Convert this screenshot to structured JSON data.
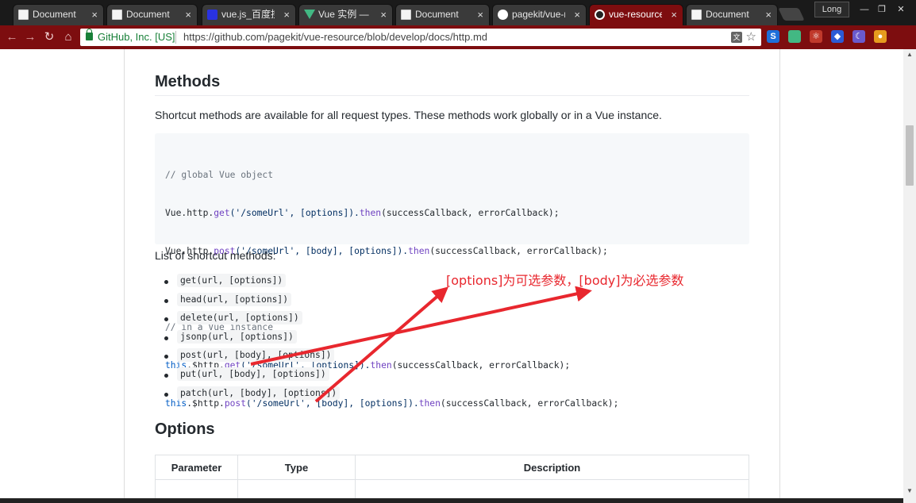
{
  "browser": {
    "tabs": [
      {
        "title": "Document",
        "favicon": "document-icon",
        "active": false
      },
      {
        "title": "Document",
        "favicon": "document-icon",
        "active": false
      },
      {
        "title": "vue.js_百度搜索",
        "favicon": "baidu-icon",
        "active": false
      },
      {
        "title": "Vue 实例 — Vue",
        "favicon": "vue-icon",
        "active": false
      },
      {
        "title": "Document",
        "favicon": "document-icon",
        "active": false
      },
      {
        "title": "pagekit/vue-re",
        "favicon": "github-icon",
        "active": false
      },
      {
        "title": "vue-resource/",
        "favicon": "github-icon",
        "active": true
      },
      {
        "title": "Document",
        "favicon": "document-icon",
        "active": false
      }
    ],
    "tab_close_glyph": "×",
    "profile_name": "Long",
    "window_controls": {
      "minimize": "—",
      "restore": "❐",
      "close": "✕"
    },
    "nav": {
      "back": "←",
      "forward": "→",
      "reload": "↻",
      "home": "⌂"
    },
    "address_bar": {
      "secure_label": "GitHub, Inc. [US]",
      "url": "https://github.com/pagekit/vue-resource/blob/develop/docs/http.md"
    },
    "extensions": [
      {
        "name": "s-extension-icon",
        "glyph": "S",
        "color": "#1e6fd9"
      },
      {
        "name": "vue-devtools-icon",
        "glyph": "",
        "color": "#42b883"
      },
      {
        "name": "react-devtools-icon",
        "glyph": "⚛",
        "color": "#c0392b"
      },
      {
        "name": "blue-extension-icon",
        "glyph": "◆",
        "color": "#2c5bd6"
      },
      {
        "name": "moon-extension-icon",
        "glyph": "☾",
        "color": "#6a5acd"
      },
      {
        "name": "cookie-extension-icon",
        "glyph": "●",
        "color": "#e69b1e"
      }
    ],
    "accent_color": "#7d0d0f"
  },
  "page": {
    "methods_heading": "Methods",
    "methods_intro": "Shortcut methods are available for all request types. These methods work globally or in a Vue instance.",
    "code": {
      "comment_global": "// global Vue object",
      "line_get_prefix": "Vue.http.",
      "line_get_fn": "get",
      "line_get_rest": "('/someUrl', [options]).",
      "line_then": "then",
      "line_get_tail": "(successCallback, errorCallback);",
      "line_post_prefix": "Vue.http.",
      "line_post_fn": "post",
      "line_post_rest": "('/someUrl', [body], [options]).",
      "line_post_tail": "(successCallback, errorCallback);",
      "comment_instance": "// in a Vue instance",
      "this_kw": "this",
      "line_iget_mid": ".$http.",
      "line_iget_rest": "('/someUrl', [options]).",
      "line_ipost_rest": "('/someUrl', [body], [options]).",
      "line_i_tail": "(successCallback, errorCallback);"
    },
    "list_intro": "List of shortcut methods:",
    "methods": [
      "get(url, [options])",
      "head(url, [options])",
      "delete(url, [options])",
      "jsonp(url, [options])",
      "post(url, [body], [options])",
      "put(url, [body], [options])",
      "patch(url, [body], [options])"
    ],
    "options_heading": "Options",
    "options_table": {
      "headers": [
        "Parameter",
        "Type",
        "Description"
      ]
    }
  },
  "annotation": {
    "text": "[options]为可选参数，[body]为必选参数",
    "color": "#e8272e"
  }
}
